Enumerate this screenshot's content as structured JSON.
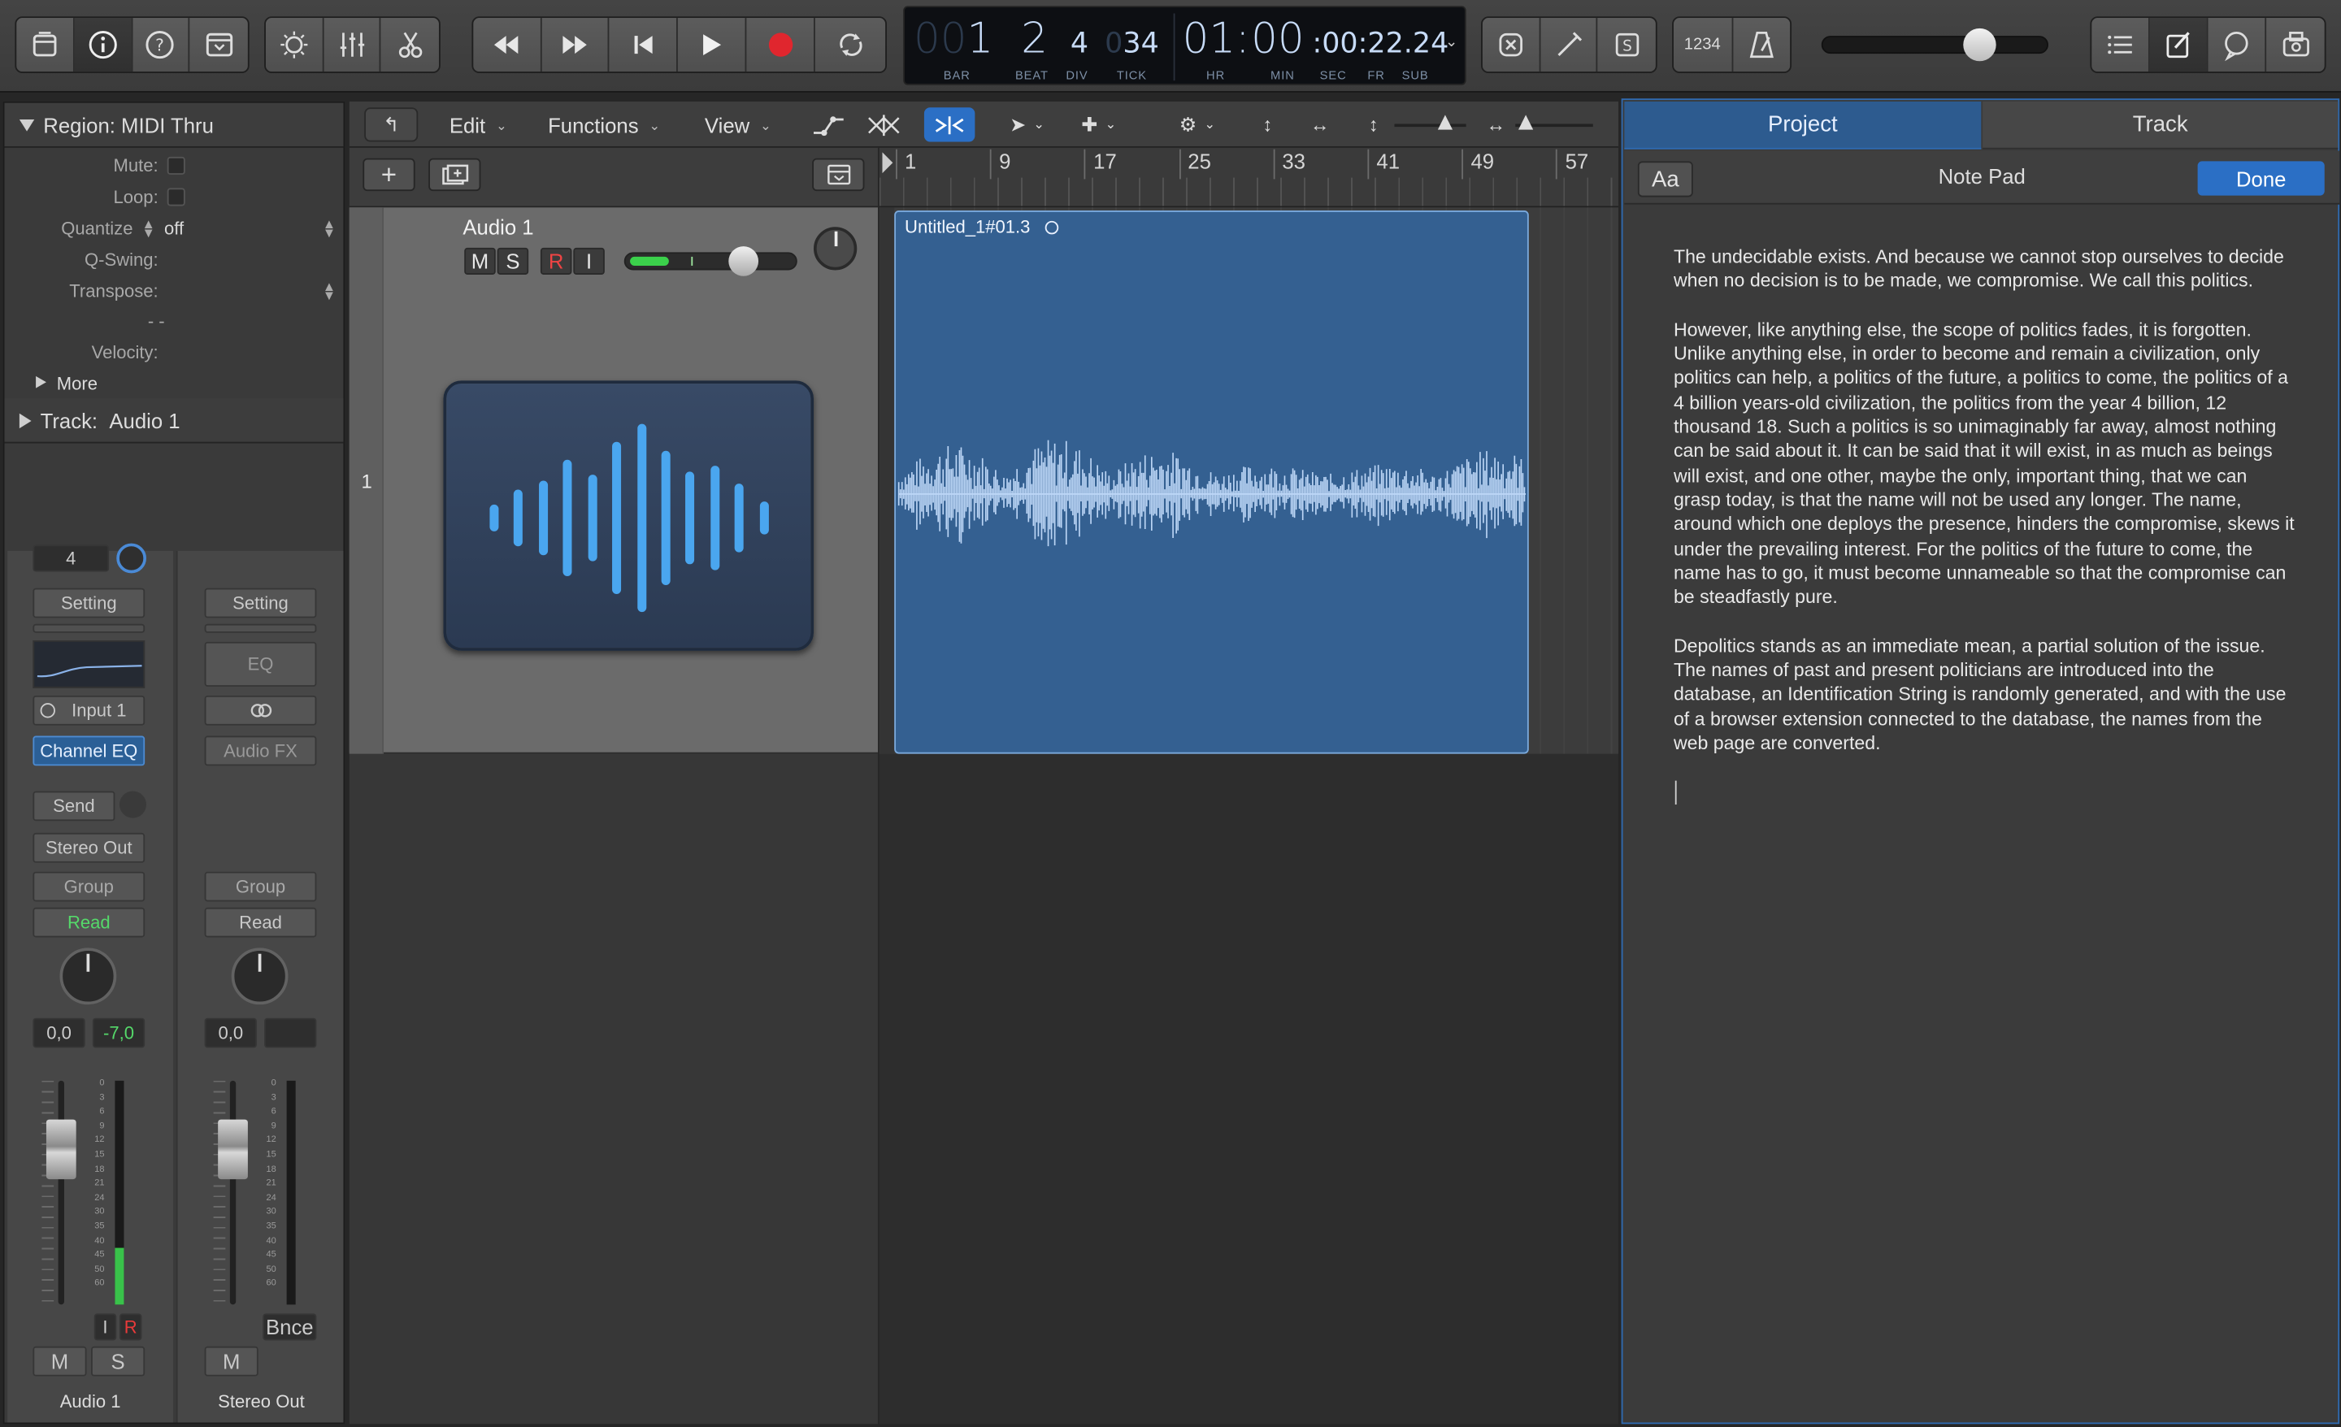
{
  "toolbar": {
    "left_icons": [
      "library-icon",
      "info-icon",
      "help-icon",
      "toolbar-icon"
    ],
    "edit_icons": [
      "smart-controls-icon",
      "mixer-icon",
      "editors-icon"
    ],
    "transport_icons": [
      "rewind-icon",
      "fast-forward-icon",
      "go-to-start-icon",
      "play-icon",
      "record-icon",
      "cycle-icon"
    ],
    "mode_icons": [
      "replace-icon",
      "tuner-icon",
      "solo-icon"
    ],
    "count_in": "1234",
    "list_icons": [
      "list-editors-icon",
      "note-pad-icon",
      "loop-browser-icon",
      "browsers-icon"
    ],
    "record_color": "#e0262e"
  },
  "lcd": {
    "bar_dim": "00",
    "bar": "1",
    "beat": "2",
    "div": "4",
    "tick_dim": "0",
    "tick": "34",
    "hr": "01:",
    "min": "00",
    "sec_sub": ":00:22.24",
    "labels": {
      "bar": "BAR",
      "beat": "BEAT",
      "div": "DIV",
      "tick": "TICK",
      "hr": "HR",
      "min": "MIN",
      "sec": "SEC",
      "fr": "FR",
      "sub": "SUB"
    }
  },
  "inspector": {
    "region_header": "Region:",
    "region_name": "MIDI Thru",
    "rows": {
      "mute": "Mute:",
      "loop": "Loop:",
      "quantize": "Quantize",
      "quantize_value": "off",
      "qswing": "Q-Swing:",
      "transpose": "Transpose:",
      "dashes": "- -",
      "velocity": "Velocity:",
      "more": "More"
    },
    "track_header": "Track:",
    "track_name": "Audio 1"
  },
  "strip1": {
    "number": "4",
    "setting": "Setting",
    "input": "Input 1",
    "channel_eq": "Channel EQ",
    "send": "Send",
    "output": "Stereo Out",
    "group": "Group",
    "automation": "Read",
    "vol": "0,0",
    "peak": "-7,0",
    "i": "I",
    "r": "R",
    "m": "M",
    "s": "S",
    "name": "Audio 1"
  },
  "strip2": {
    "setting": "Setting",
    "eq": "EQ",
    "audio_fx": "Audio FX",
    "group": "Group",
    "automation": "Read",
    "vol": "0,0",
    "bnce": "Bnce",
    "m": "M",
    "name": "Stereo Out"
  },
  "fader_scale": [
    "0",
    "3",
    "6",
    "9",
    "12",
    "15",
    "18",
    "21",
    "24",
    "30",
    "35",
    "40",
    "45",
    "50",
    "60"
  ],
  "tracks_toolbar": {
    "edit": "Edit",
    "functions": "Functions",
    "view": "View"
  },
  "ruler": {
    "bars": [
      "1",
      "9",
      "17",
      "25",
      "33",
      "41",
      "49",
      "57"
    ]
  },
  "track": {
    "number": "1",
    "name": "Audio 1",
    "m": "M",
    "s": "S",
    "r": "R",
    "i": "I"
  },
  "region": {
    "name": "Untitled_1#01.3"
  },
  "right_panel": {
    "tab_project": "Project",
    "tab_track": "Track",
    "aa": "Aa",
    "title": "Note Pad",
    "done": "Done",
    "paragraphs": [
      "The undecidable exists. And because we cannot stop ourselves to decide when no decision is to be made, we compromise. We call this politics.",
      "However, like anything else, the scope of politics fades, it is forgotten. Unlike anything else, in order to become and remain a civilization, only politics can help, a politics of the future, a politics to come, the politics of a 4 billion years-old civilization, the politics from the year 4 billion, 12 thousand 18. Such a politics is so unimaginably far away, almost nothing can be said about it. It can be said that it will exist, in as much as beings will exist, and one other, maybe the only, important thing, that we can grasp today, is that the name will not be used any longer. The name, around which one deploys the presence, hinders the compromise, skews it under the prevailing interest. For the politics of the future to come, the name has to go, it must become unnameable so that the compromise can be steadfastly pure.",
      "Depolitics stands as an immediate mean, a partial solution of the issue. The names of past and present politicians are introduced into the database, an Identification String is randomly generated, and with the use of a browser extension connected to the database, the names from the web page are converted."
    ]
  }
}
